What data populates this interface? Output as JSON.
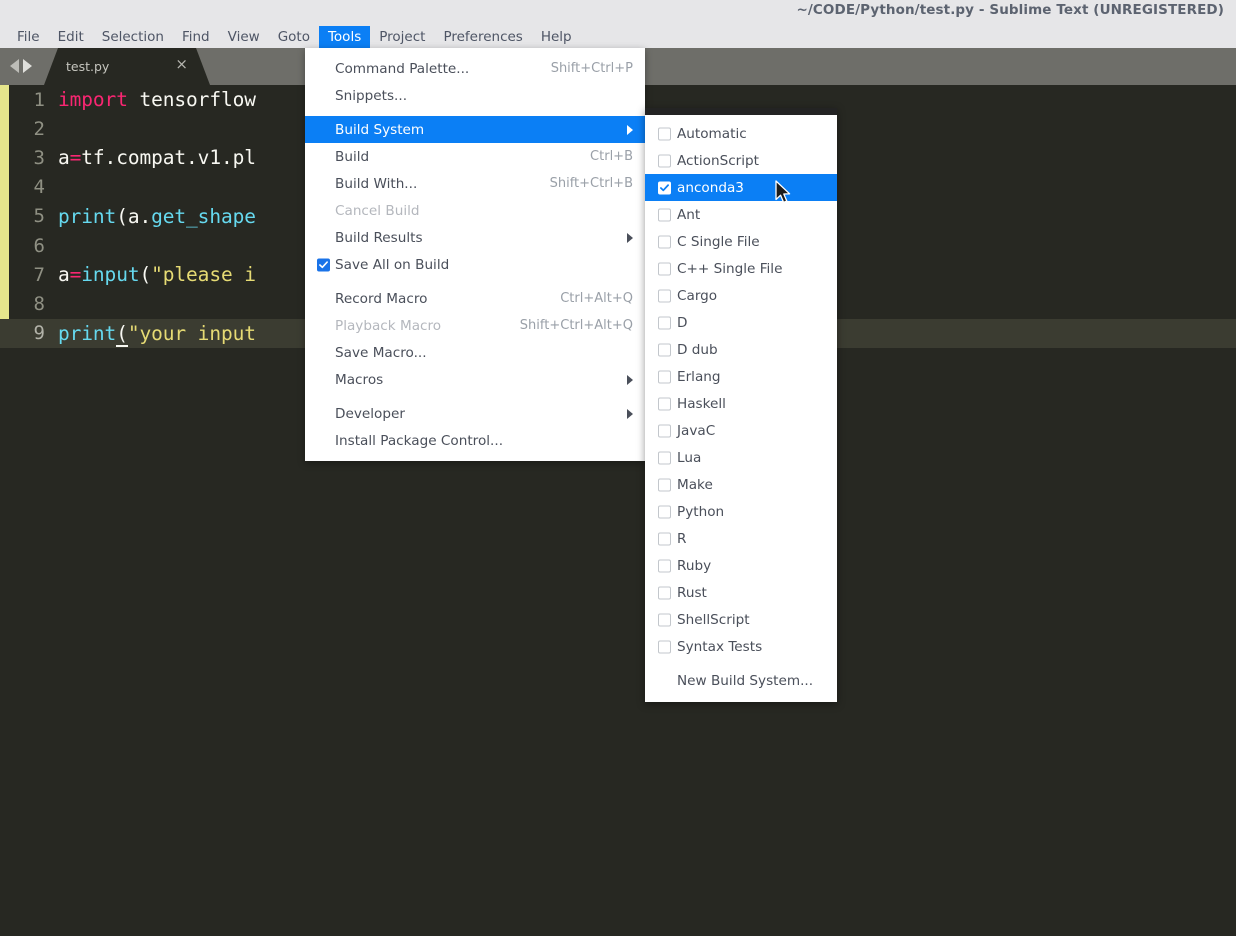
{
  "window": {
    "title": "~/CODE/Python/test.py - Sublime Text (UNREGISTERED)"
  },
  "menubar": {
    "items": [
      {
        "label": "File",
        "active": false
      },
      {
        "label": "Edit",
        "active": false
      },
      {
        "label": "Selection",
        "active": false
      },
      {
        "label": "Find",
        "active": false
      },
      {
        "label": "View",
        "active": false
      },
      {
        "label": "Goto",
        "active": false
      },
      {
        "label": "Tools",
        "active": true
      },
      {
        "label": "Project",
        "active": false
      },
      {
        "label": "Preferences",
        "active": false
      },
      {
        "label": "Help",
        "active": false
      }
    ]
  },
  "tabbar": {
    "tab_label": "test.py",
    "close_glyph": "×",
    "nav_prev_icon": "arrow-left-icon",
    "nav_next_icon": "arrow-right-icon"
  },
  "editor": {
    "lines": [
      {
        "num": "1",
        "text": "import tensorflow",
        "current": false
      },
      {
        "num": "2",
        "text": "",
        "current": false
      },
      {
        "num": "3",
        "text": "a=tf.compat.v1.pl",
        "current": false
      },
      {
        "num": "4",
        "text": "",
        "current": false
      },
      {
        "num": "5",
        "text": "print(a.get_shape",
        "current": false
      },
      {
        "num": "6",
        "text": "",
        "current": false
      },
      {
        "num": "7",
        "text": "a=input(\"please i",
        "current": false
      },
      {
        "num": "8",
        "text": "",
        "current": false
      },
      {
        "num": "9",
        "text": "print(\"your input",
        "current": true
      }
    ],
    "accent_strip_color": "#e6e68c",
    "background_color": "#272822"
  },
  "tools_menu": {
    "items": [
      {
        "label": "Command Palette...",
        "shortcut": "Shift+Ctrl+P",
        "type": "item"
      },
      {
        "label": "Snippets...",
        "shortcut": "",
        "type": "item"
      },
      {
        "type": "gap"
      },
      {
        "label": "Build System",
        "shortcut": "",
        "type": "submenu",
        "selected": true
      },
      {
        "label": "Build",
        "shortcut": "Ctrl+B",
        "type": "item"
      },
      {
        "label": "Build With...",
        "shortcut": "Shift+Ctrl+B",
        "type": "item"
      },
      {
        "label": "Cancel Build",
        "shortcut": "",
        "type": "item",
        "disabled": true
      },
      {
        "label": "Build Results",
        "shortcut": "",
        "type": "submenu"
      },
      {
        "label": "Save All on Build",
        "shortcut": "",
        "type": "checkbox",
        "checked": true
      },
      {
        "type": "gap"
      },
      {
        "label": "Record Macro",
        "shortcut": "Ctrl+Alt+Q",
        "type": "item"
      },
      {
        "label": "Playback Macro",
        "shortcut": "Shift+Ctrl+Alt+Q",
        "type": "item",
        "disabled": true
      },
      {
        "label": "Save Macro...",
        "shortcut": "",
        "type": "item"
      },
      {
        "label": "Macros",
        "shortcut": "",
        "type": "submenu"
      },
      {
        "type": "gap"
      },
      {
        "label": "Developer",
        "shortcut": "",
        "type": "submenu"
      },
      {
        "label": "Install Package Control...",
        "shortcut": "",
        "type": "item"
      }
    ]
  },
  "build_system_submenu": {
    "items": [
      {
        "label": "Automatic",
        "checked": false
      },
      {
        "label": "ActionScript",
        "checked": false
      },
      {
        "label": "anconda3",
        "checked": true,
        "selected": true
      },
      {
        "label": "Ant",
        "checked": false
      },
      {
        "label": "C Single File",
        "checked": false
      },
      {
        "label": "C++ Single File",
        "checked": false
      },
      {
        "label": "Cargo",
        "checked": false
      },
      {
        "label": "D",
        "checked": false
      },
      {
        "label": "D dub",
        "checked": false
      },
      {
        "label": "Erlang",
        "checked": false
      },
      {
        "label": "Haskell",
        "checked": false
      },
      {
        "label": "JavaC",
        "checked": false
      },
      {
        "label": "Lua",
        "checked": false
      },
      {
        "label": "Make",
        "checked": false
      },
      {
        "label": "Python",
        "checked": false
      },
      {
        "label": "R",
        "checked": false
      },
      {
        "label": "Ruby",
        "checked": false
      },
      {
        "label": "Rust",
        "checked": false
      },
      {
        "label": "ShellScript",
        "checked": false
      },
      {
        "label": "Syntax Tests",
        "checked": false
      }
    ],
    "footer_label": "New Build System..."
  },
  "colors": {
    "highlight_blue": "#0b7ff5",
    "titlebar_bg": "#e6e6e8",
    "tabbar_bg": "#6e6e69",
    "editor_bg": "#272822",
    "keyword_pink": "#f92672",
    "function_cyan": "#66d9ef",
    "string_yellow": "#e6db74"
  }
}
